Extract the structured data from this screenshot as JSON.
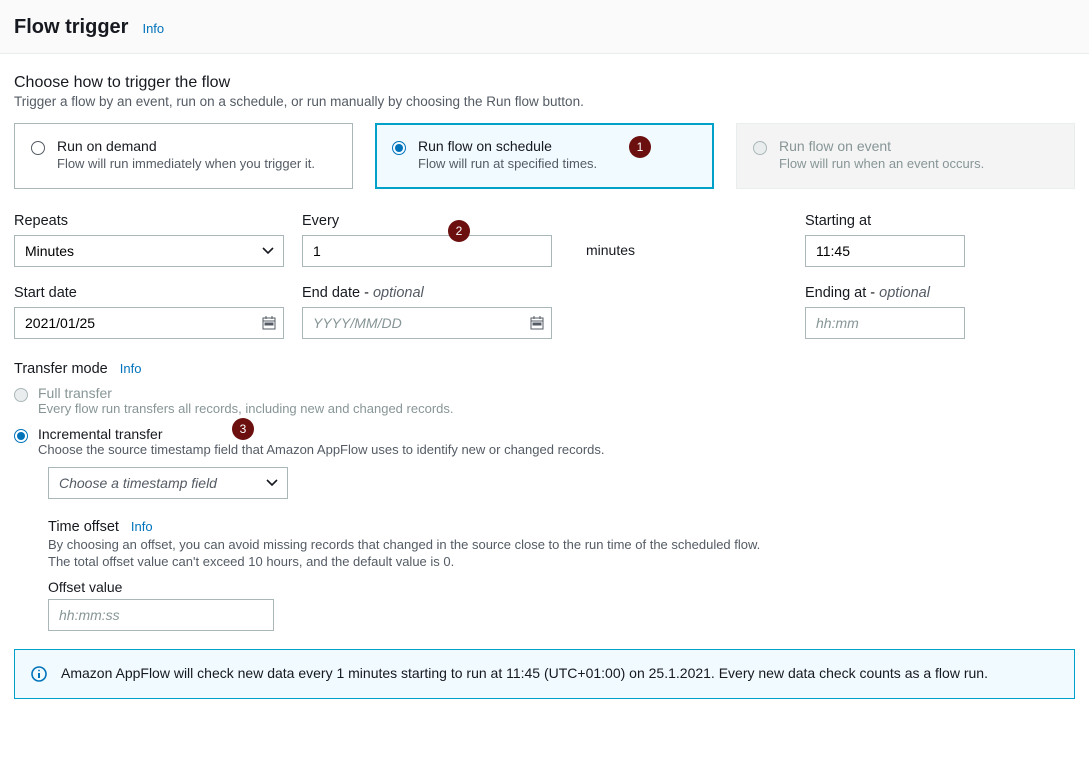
{
  "header": {
    "title": "Flow trigger",
    "info_label": "Info"
  },
  "trigger_choice": {
    "heading": "Choose how to trigger the flow",
    "description": "Trigger a flow by an event, run on a schedule, or run manually by choosing the Run flow button.",
    "options": [
      {
        "title": "Run on demand",
        "desc": "Flow will run immediately when you trigger it.",
        "selected": false,
        "disabled": false
      },
      {
        "title": "Run flow on schedule",
        "desc": "Flow will run at specified times.",
        "selected": true,
        "disabled": false
      },
      {
        "title": "Run flow on event",
        "desc": "Flow will run when an event occurs.",
        "selected": false,
        "disabled": true
      }
    ]
  },
  "callouts": {
    "c1": "1",
    "c2": "2",
    "c3": "3"
  },
  "schedule": {
    "repeats_label": "Repeats",
    "repeats_value": "Minutes",
    "every_label": "Every",
    "every_value": "1",
    "every_units": "minutes",
    "starting_at_label": "Starting at",
    "starting_at_value": "11:45",
    "start_date_label": "Start date",
    "start_date_value": "2021/01/25",
    "end_date_label": "End date - ",
    "end_date_optional": "optional",
    "end_date_placeholder": "YYYY/MM/DD",
    "ending_at_label": "Ending at - ",
    "ending_at_optional": "optional",
    "ending_at_placeholder": "hh:mm"
  },
  "transfer": {
    "heading": "Transfer mode",
    "info_label": "Info",
    "full": {
      "title": "Full transfer",
      "desc": "Every flow run transfers all records, including new and changed records."
    },
    "incremental": {
      "title": "Incremental transfer",
      "desc": "Choose the source timestamp field that Amazon AppFlow uses to identify new or changed records."
    },
    "timestamp_placeholder": "Choose a timestamp field",
    "offset": {
      "title": "Time offset",
      "info_label": "Info",
      "desc1": "By choosing an offset, you can avoid missing records that changed in the source close to the run time of the scheduled flow.",
      "desc2": "The total offset value can't exceed 10 hours, and the default value is 0.",
      "value_label": "Offset value",
      "placeholder": "hh:mm:ss"
    }
  },
  "info_message": "Amazon AppFlow will check new data every 1 minutes starting to run at 11:45 (UTC+01:00) on 25.1.2021. Every new data check counts as a flow run."
}
